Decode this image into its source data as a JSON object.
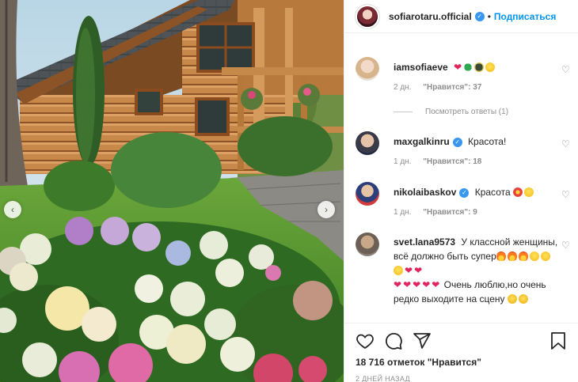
{
  "header": {
    "username": "sofiarotaru.official",
    "separator": "•",
    "follow_label": "Подписаться"
  },
  "comments": [
    {
      "username": "iamsofiaeve",
      "text": "",
      "emojis": [
        "red-heart",
        "four-leaf-clover",
        "sunglasses-face",
        "heart-eyes-face"
      ],
      "time": "2 дн.",
      "likes": "\"Нравится\": 37",
      "view_replies": "Посмотреть ответы (1)"
    },
    {
      "username": "maxgalkinru",
      "verified": true,
      "text": "Красота!",
      "time": "1 дн.",
      "likes": "\"Нравится\": 18"
    },
    {
      "username": "nikolaibaskov",
      "verified": true,
      "text": "Красота",
      "emojis": [
        "collision",
        "face-blowing-kiss"
      ],
      "time": "1 дн.",
      "likes": "\"Нравится\": 9"
    },
    {
      "username": "svet.lana9573",
      "text_line1": "У классной женщины, всё должно быть супер",
      "text_line3": "Очень люблю,но очень редко выходите на сцену"
    }
  ],
  "actions": {
    "icons": [
      "heart-icon",
      "comment-icon",
      "share-icon",
      "bookmark-icon"
    ],
    "likes_count": "18 716 отметок \"Нравится\"",
    "post_time": "2 ДНЕЙ НАЗАД"
  },
  "photo": {
    "prev_arrow": "‹",
    "next_arrow": "›"
  },
  "colors": {
    "accent": "#0095f6",
    "verified": "#3897f0",
    "muted": "#8e8e8e"
  }
}
